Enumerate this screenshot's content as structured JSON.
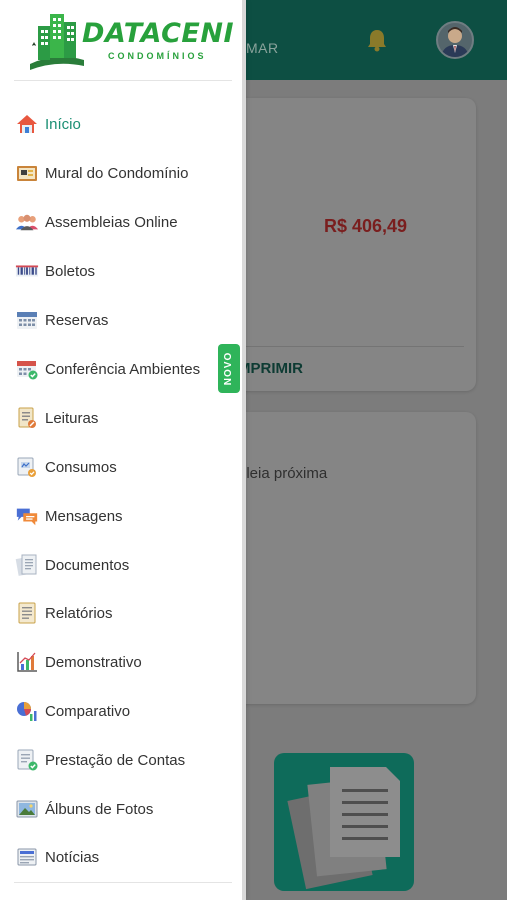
{
  "app": {
    "header_tab": "MAR",
    "amount": "R$ 406,49",
    "print_label": "MPRIMIR",
    "assembly_text": "bleia próxima"
  },
  "logo": {
    "brand": "DATACENI",
    "subtitle": "CONDOMÍNIOS"
  },
  "menu": {
    "items": [
      {
        "label": "Início",
        "icon": "home-icon"
      },
      {
        "label": "Mural do Condomínio",
        "icon": "bulletin-board-icon"
      },
      {
        "label": "Assembleias Online",
        "icon": "people-icon"
      },
      {
        "label": "Boletos",
        "icon": "barcode-icon"
      },
      {
        "label": "Reservas",
        "icon": "calendar-icon"
      },
      {
        "label": "Conferência Ambientes",
        "icon": "calendar-check-icon"
      },
      {
        "label": "Leituras",
        "icon": "meter-reading-icon"
      },
      {
        "label": "Consumos",
        "icon": "consumption-icon"
      },
      {
        "label": "Mensagens",
        "icon": "chat-icon"
      },
      {
        "label": "Documentos",
        "icon": "documents-icon"
      },
      {
        "label": "Relatórios",
        "icon": "report-icon"
      },
      {
        "label": "Demonstrativo",
        "icon": "chart-icon"
      },
      {
        "label": "Comparativo",
        "icon": "compare-chart-icon"
      },
      {
        "label": "Prestação de Contas",
        "icon": "accounts-icon"
      },
      {
        "label": "Álbuns de Fotos",
        "icon": "photo-album-icon"
      },
      {
        "label": "Notícias",
        "icon": "news-icon"
      }
    ],
    "new_badge": "NOVO"
  },
  "colors": {
    "accent": "#1b8f74",
    "brand_green": "#28a13c",
    "badge_green": "#2fb45a",
    "app_bar": "#0d4f43"
  }
}
